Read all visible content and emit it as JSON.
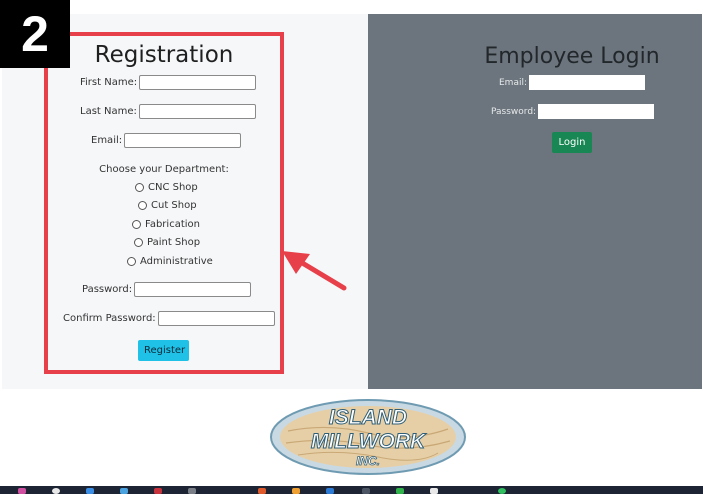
{
  "step_badge": "2",
  "registration": {
    "title": "Registration",
    "first_name_label": "First Name:",
    "last_name_label": "Last Name:",
    "email_label": "Email:",
    "department_heading": "Choose your Department:",
    "departments": [
      "CNC Shop",
      "Cut Shop",
      "Fabrication",
      "Paint Shop",
      "Administrative"
    ],
    "password_label": "Password:",
    "confirm_password_label": "Confirm Password:",
    "register_button": "Register"
  },
  "employee_login": {
    "title": "Employee Login",
    "email_label": "Email:",
    "password_label": "Password:",
    "login_button": "Login"
  },
  "logo": {
    "line1": "ISLAND",
    "line2": "MILLWORK",
    "line3": "INC."
  },
  "colors": {
    "highlight_frame": "#e8404a",
    "register_button": "#1fc1e6",
    "login_button": "#198754",
    "login_panel": "#6c757d"
  }
}
